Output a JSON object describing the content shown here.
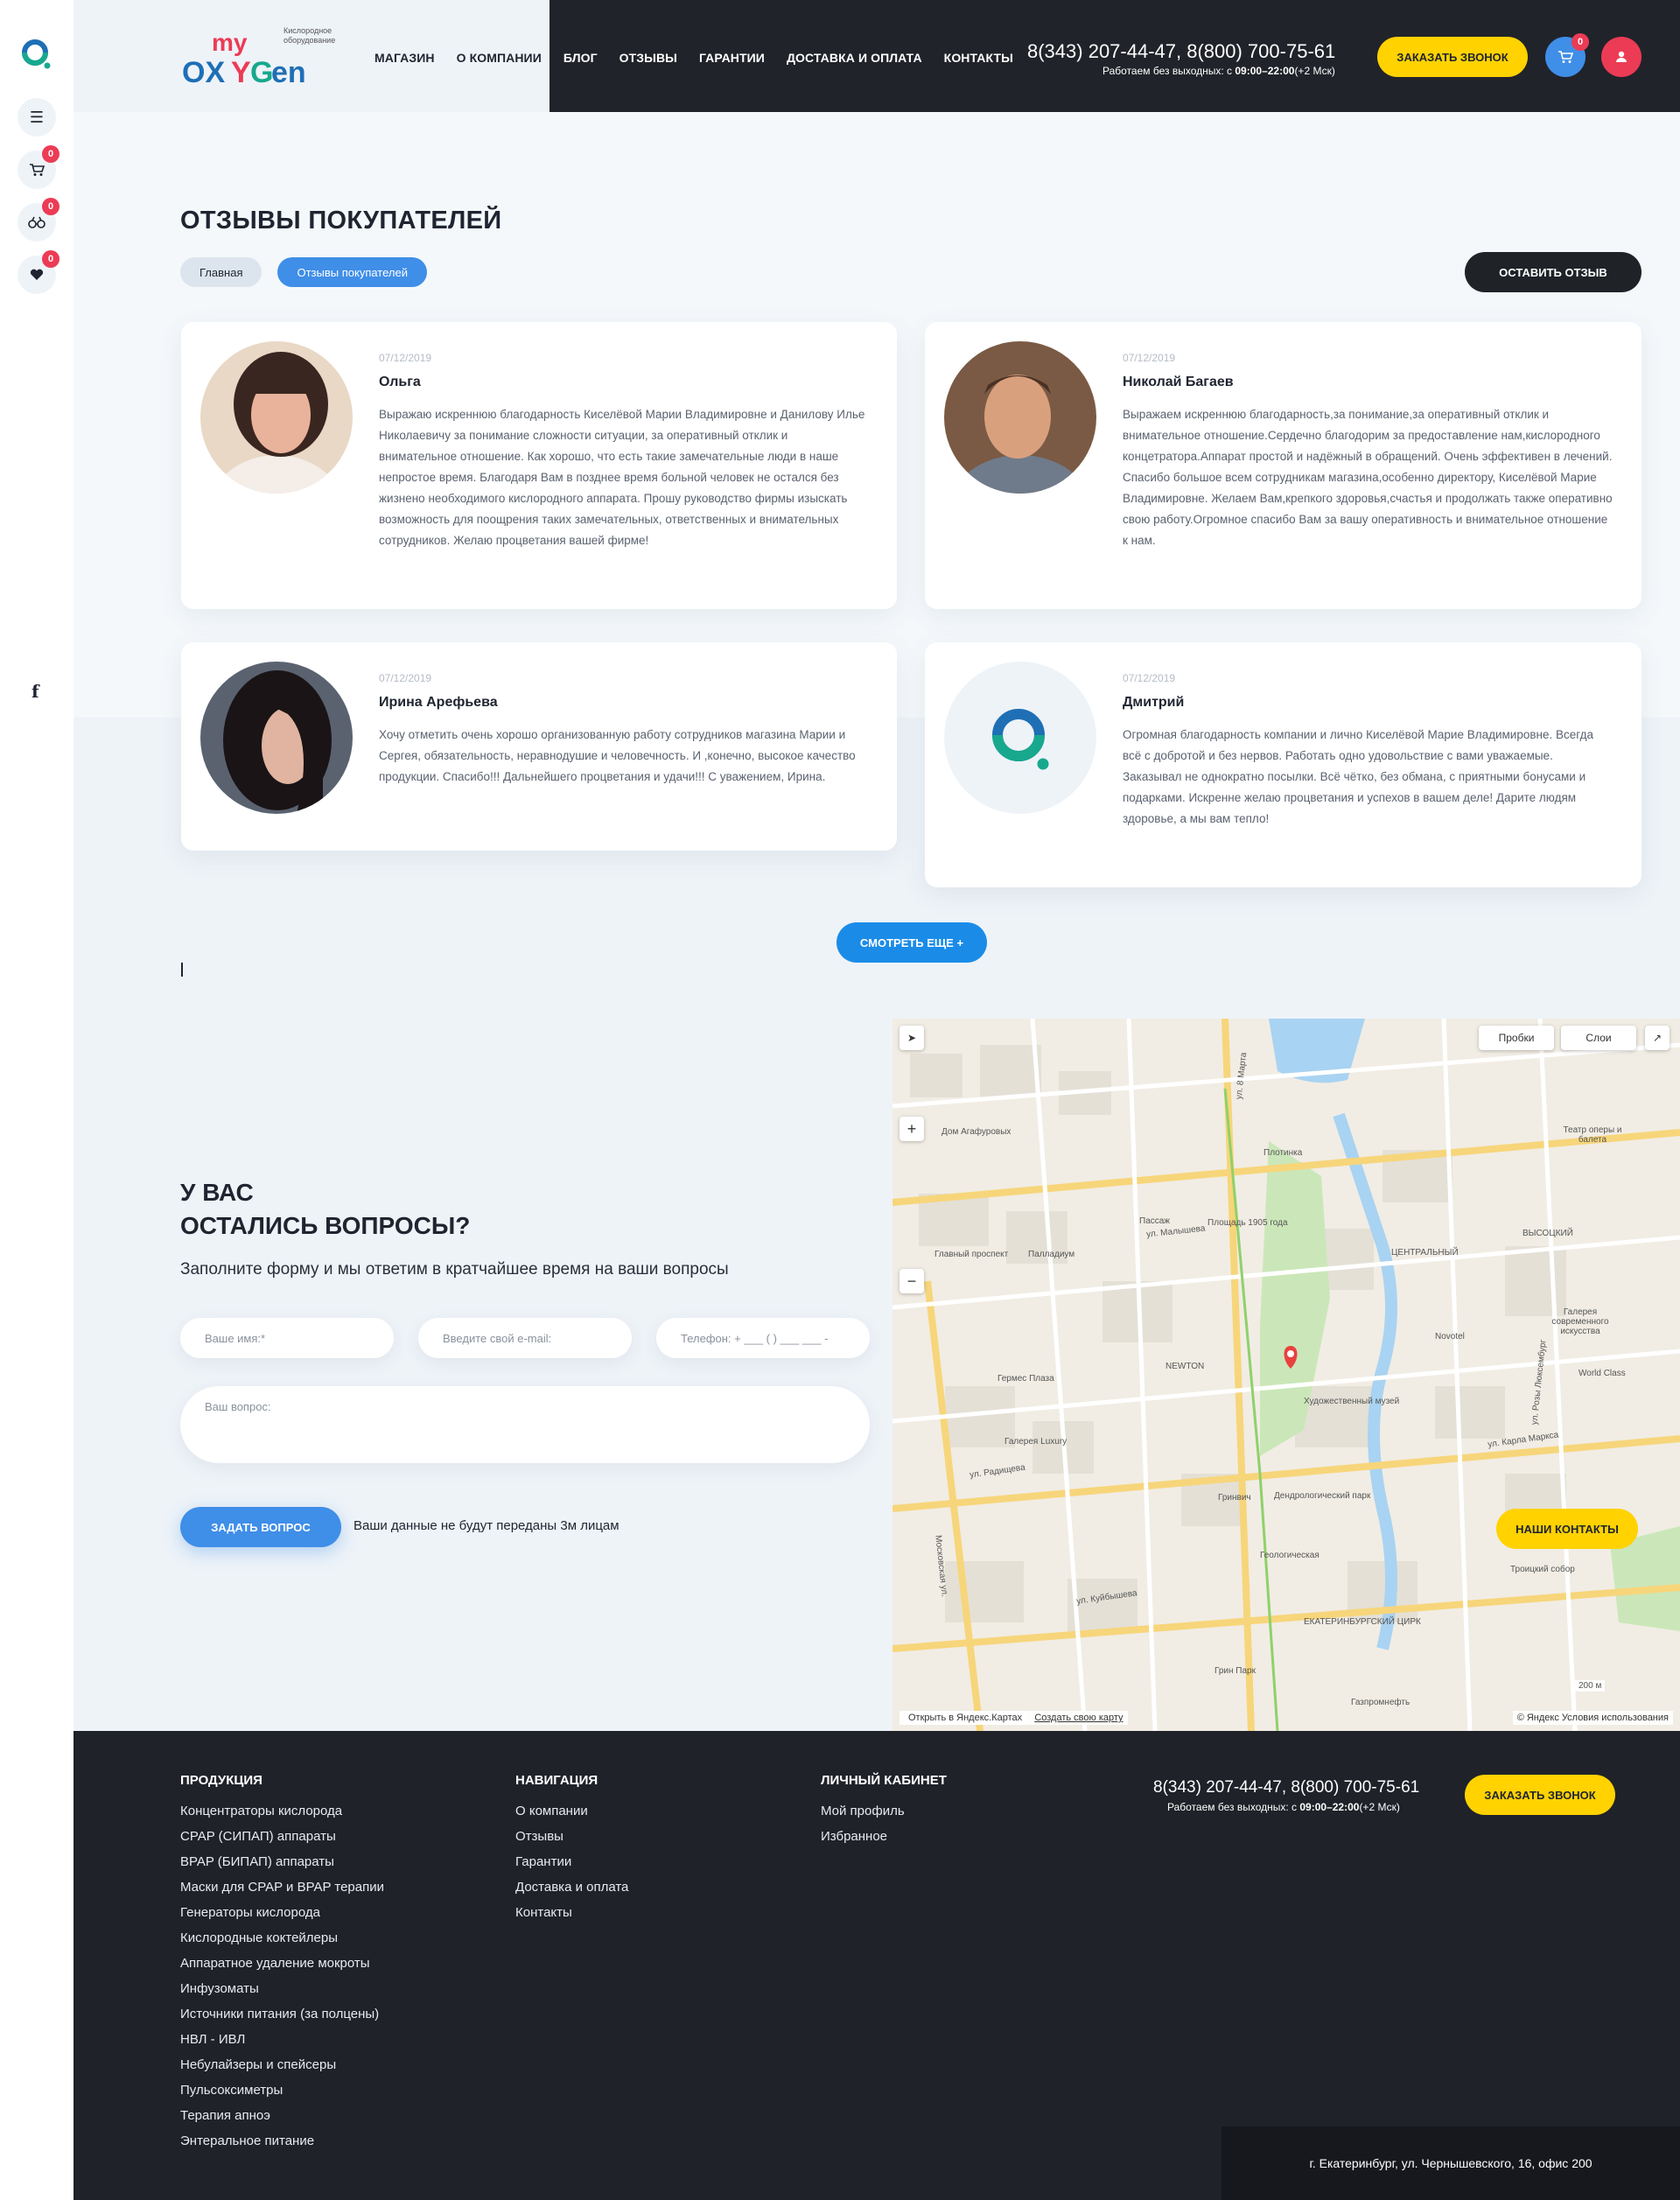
{
  "brand": {
    "logo_text": "my OXYGEN",
    "tagline": "Кислородное оборудование"
  },
  "rail": {
    "cart_count": "0",
    "compare_count": "0",
    "favorites_count": "0",
    "social_label": "f"
  },
  "nav": {
    "items": [
      "МАГАЗИН",
      "О КОМПАНИИ",
      "БЛОГ",
      "ОТЗЫВЫ",
      "ГАРАНТИИ",
      "ДОСТАВКА И ОПЛАТА",
      "КОНТАКТЫ"
    ]
  },
  "header": {
    "phones": "8(343) 207-44-47, 8(800) 700-75-61",
    "hours_prefix": "Работаем без выходных: с ",
    "hours_time": "09:00–22:00",
    "hours_suffix": "(+2 Мск)",
    "call_button": "ЗАКАЗАТЬ ЗВОНОК",
    "cart_count": "0"
  },
  "page": {
    "title": "ОТЗЫВЫ ПОКУПАТЕЛЕЙ",
    "breadcrumb_home": "Главная",
    "breadcrumb_current": "Отзывы покупателей",
    "leave_review_button": "ОСТАВИТЬ ОТЗЫВ",
    "more_button": "СМОТРЕТЬ ЕЩЕ +"
  },
  "reviews": [
    {
      "date": "07/12/2019",
      "name": "Ольга",
      "text": "Выражаю искреннюю благодарность Киселёвой Марии Владимировне и Данилову Илье Николаевичу за понимание сложности ситуации, за оперативный отклик и внимательное отношение. Как хорошо, что есть такие замечательные люди в наше непростое время. Благодаря Вам в позднее время больной человек не остался без жизнено необходимого кислородного аппарата. Прошу руководство фирмы изыскать возможность для поощрения таких замечательных, ответственных и внимательных сотрудников. Желаю процветания вашей фирме!"
    },
    {
      "date": "07/12/2019",
      "name": "Николай Багаев",
      "text": "Выражаем искреннюю благодарность,за понимание,за оперативный отклик и внимательное отношение.Сердечно благодорим за предоставление нам,кислородного концетратора.Аппарат простой и надёжный в обращений. Очень эффективен в лечений. Спасибо большое всем сотрудникам магазина,особенно директору, Киселёвой Марие Владимировне. Желаем Вам,крепкого здоровья,счастья и продолжать также оперативно свою работу.Огромное спасибо Вам за вашу оперативность и внимательное отношение к нам."
    },
    {
      "date": "07/12/2019",
      "name": "Ирина Арефьева",
      "text": "Хочу отметить очень хорошо организованную работу сотрудников магазина Марии и Сергея, обязательность, неравнодушие и человечность. И ,конечно, высокое качество продукции. Спасибо!!! Дальнейшего процветания и удачи!!! С уважением, Ирина."
    },
    {
      "date": "07/12/2019",
      "name": "Дмитрий",
      "text": "Огромная благодарность компании и лично Киселёвой Марие Владимировне. Всегда всё с добротой и без нервов. Работать одно удовольствие с вами уважаемые. Заказывал не однократно посылки. Всё чётко, без обмана, с приятными бонусами и подарками. Искренне желаю процветания и успехов в вашем деле! Дарите людям здоровье, а мы вам тепло!"
    }
  ],
  "questions": {
    "title_line1": "У ВАС",
    "title_line2": "ОСТАЛИСЬ ВОПРОСЫ?",
    "subtitle": "Заполните форму и мы ответим в кратчайшее время на ваши вопросы",
    "name_placeholder": "Ваше имя:*",
    "email_placeholder": "Введите свой e-mail:",
    "phone_placeholder": "Телефон: + ___ (      ) ___ ___ -",
    "question_placeholder": "Ваш вопрос:",
    "submit_button": "ЗАДАТЬ ВОПРОС",
    "privacy_note": "Ваши данные не будут переданы 3м лицам"
  },
  "map": {
    "traffic_label": "Пробки",
    "layers_label": "Слои",
    "contacts_button": "НАШИ КОНТАКТЫ",
    "open_in_yandex": "Открыть в Яндекс.Картах",
    "create_map": "Создать свою карту",
    "scale": "200 м",
    "copyright": "© Яндекс Условия использования",
    "labels": [
      "ул. Малышева",
      "ул. 8 Марта",
      "Пассаж",
      "Площадь 1905 года",
      "Художественный музей",
      "Дендрологический парк",
      "Геологическая",
      "ЕКАТЕРИНБУРГСКИЙ ЦИРК",
      "ул. Куйбышева",
      "Гринвич",
      "Галерея Luxury",
      "Гермес Плаза",
      "Палладиум",
      "NEWTON",
      "Дом Агафуровых",
      "Главный проспект",
      "ул. Радищева",
      "Московская ул.",
      "Novotel",
      "World Class",
      "ЦЕНТРАЛЬНЫЙ",
      "ВЫСОЦКИЙ",
      "Галерея современного искусства",
      "Театр оперы и балета",
      "Плотинка",
      "Троицкий собор",
      "Грин Парк",
      "Газпромнефть",
      "ул. Карла Маркса",
      "ул. Розы Люксембург"
    ]
  },
  "footer": {
    "products_head": "ПРОДУКЦИЯ",
    "products": [
      "Концентраторы кислорода",
      "CPAP (СИПАП) аппараты",
      "BPAP (БИПАП) аппараты",
      "Маски для CPAP и BPAP терапии",
      "Генераторы кислорода",
      "Кислородные коктейлеры",
      "Аппаратное удаление мокроты",
      "Инфузоматы",
      "Источники питания (за полцены)",
      "НВЛ - ИВЛ",
      "Небулайзеры и спейсеры",
      "Пульсоксиметры",
      "Терапия апноэ",
      "Энтеральное питание"
    ],
    "navigation_head": "НАВИГАЦИЯ",
    "navigation": [
      "О компании",
      "Отзывы",
      "Гарантии",
      "Доставка и оплата",
      "Контакты"
    ],
    "account_head": "ЛИЧНЫЙ КАБИНЕТ",
    "account": [
      "Мой профиль",
      "Избранное"
    ],
    "phones": "8(343) 207-44-47, 8(800) 700-75-61",
    "hours_prefix": "Работаем без выходных: с ",
    "hours_time": "09:00–22:00",
    "hours_suffix": "(+2 Мск)",
    "call_button": "ЗАКАЗАТЬ ЗВОНОК",
    "address": "г. Екатеринбург, ул. Чернышевского, 16, офис 200"
  },
  "colors": {
    "accent_blue": "#3f8ee8",
    "accent_yellow": "#ffd200",
    "badge_red": "#ec3b55",
    "dark": "#21232a"
  }
}
